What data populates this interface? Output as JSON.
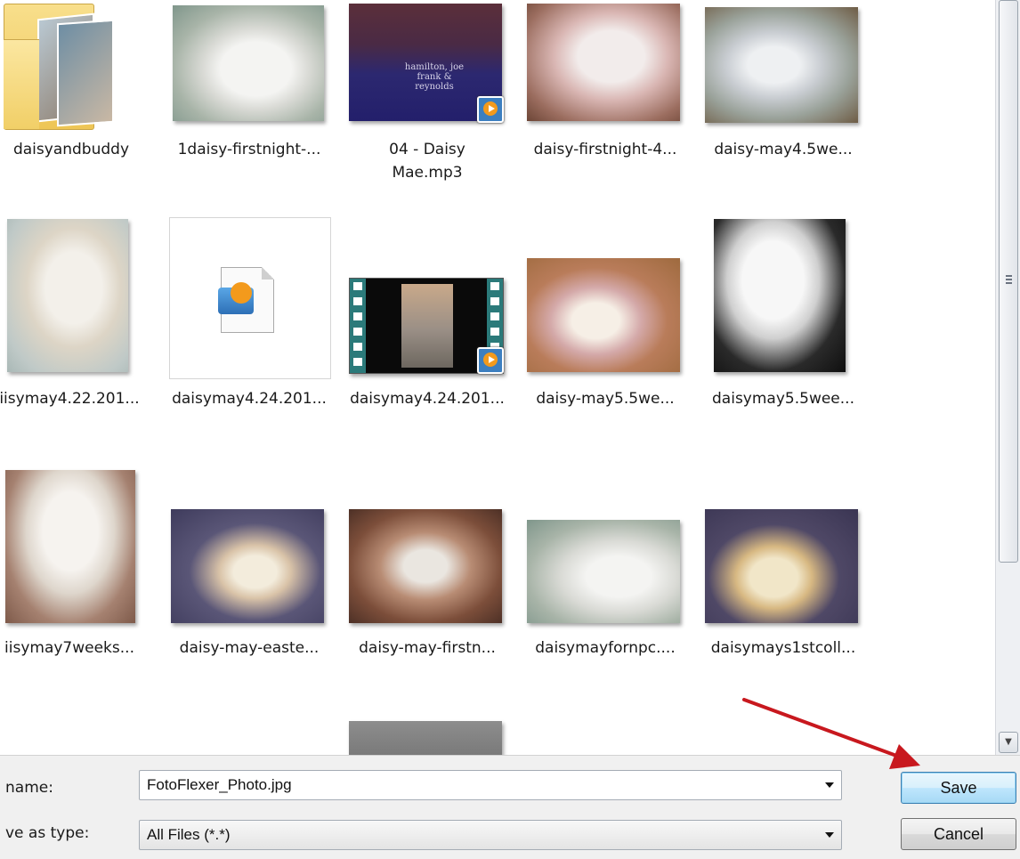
{
  "files": {
    "row1": [
      {
        "name": "daisyandbuddy"
      },
      {
        "name": "1daisy-firstnight-..."
      },
      {
        "name": "04 - Daisy",
        "name2": "Mae.mp3",
        "album_text": "hamilton, joe frank & reynolds"
      },
      {
        "name": "daisy-firstnight-4..."
      },
      {
        "name": "daisy-may4.5we..."
      }
    ],
    "row2": [
      {
        "name": "iisymay4.22.201..."
      },
      {
        "name": "daisymay4.24.201..."
      },
      {
        "name": "daisymay4.24.201..."
      },
      {
        "name": "daisy-may5.5we..."
      },
      {
        "name": "daisymay5.5wee..."
      }
    ],
    "row3": [
      {
        "name": "iisymay7weeks..."
      },
      {
        "name": "daisy-may-easte..."
      },
      {
        "name": "daisy-may-firstn..."
      },
      {
        "name": "daisymayfornpc...."
      },
      {
        "name": "daisymays1stcoll..."
      }
    ]
  },
  "form": {
    "file_name_label": "name:",
    "file_name_value": "FotoFlexer_Photo.jpg",
    "save_type_label": "ve as type:",
    "save_type_value": "All Files (*.*)"
  },
  "buttons": {
    "save": "Save",
    "cancel": "Cancel"
  },
  "colors": {
    "annotation_arrow": "#c8181e",
    "focus_border": "#3c7fb1"
  }
}
